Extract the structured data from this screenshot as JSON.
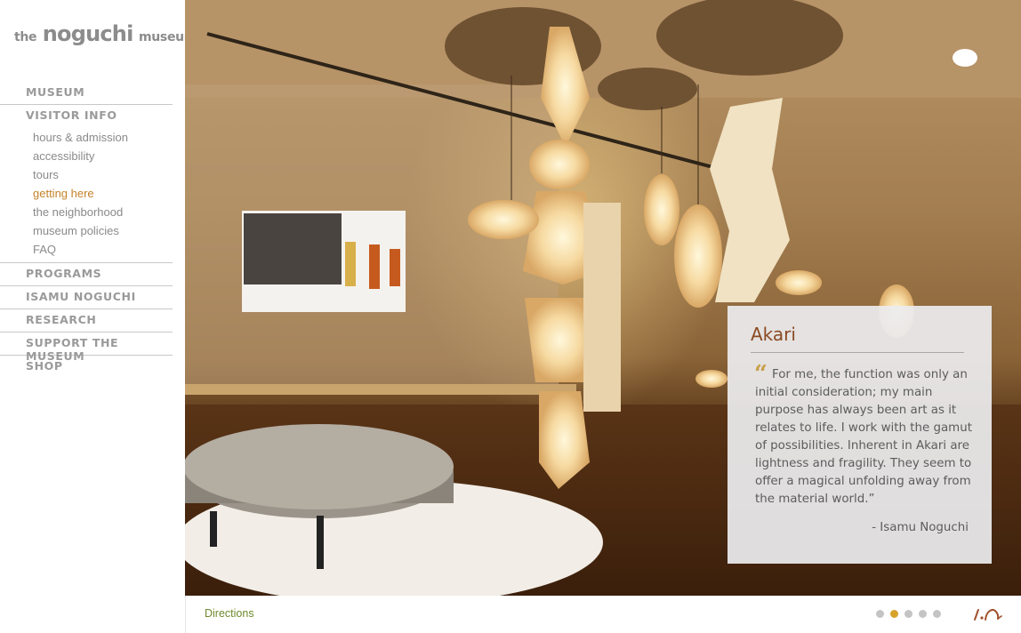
{
  "brand": {
    "prefix": "the",
    "name": "noguchi",
    "suffix": "museum"
  },
  "nav": {
    "items": [
      {
        "label": "MUSEUM"
      },
      {
        "label": "VISITOR INFO"
      },
      {
        "label": "PROGRAMS"
      },
      {
        "label": "ISAMU NOGUCHI"
      },
      {
        "label": "RESEARCH"
      },
      {
        "label": "SUPPORT THE MUSEUM"
      },
      {
        "label": "SHOP"
      }
    ],
    "visitor_info_subitems": [
      {
        "label": "hours & admission"
      },
      {
        "label": "accessibility"
      },
      {
        "label": "tours"
      },
      {
        "label": "getting here",
        "active": true
      },
      {
        "label": "the neighborhood"
      },
      {
        "label": "museum policies"
      },
      {
        "label": "FAQ"
      }
    ]
  },
  "quote_card": {
    "title": "Akari",
    "quote_mark": "“",
    "quote": "For me, the function was only an initial consideration; my main purpose has always been art as it relates to life. I work with the gamut of possibilities. Inherent in Akari are lightness and fragility. They seem to offer a magical unfolding away from the material world.”",
    "author": "- Isamu Noguchi"
  },
  "footer": {
    "directions_label": "Directions",
    "slides": {
      "count": 5,
      "active_index": 1
    }
  },
  "colors": {
    "accent": "#c4822a",
    "link_green": "#6e8a2e",
    "dot_active": "#d7a22a",
    "dot_inactive": "#c4c4c4",
    "title_brown": "#8a4a22"
  },
  "icons": {
    "signature": "noguchi-signature-icon",
    "quote": "quote-mark-icon"
  }
}
